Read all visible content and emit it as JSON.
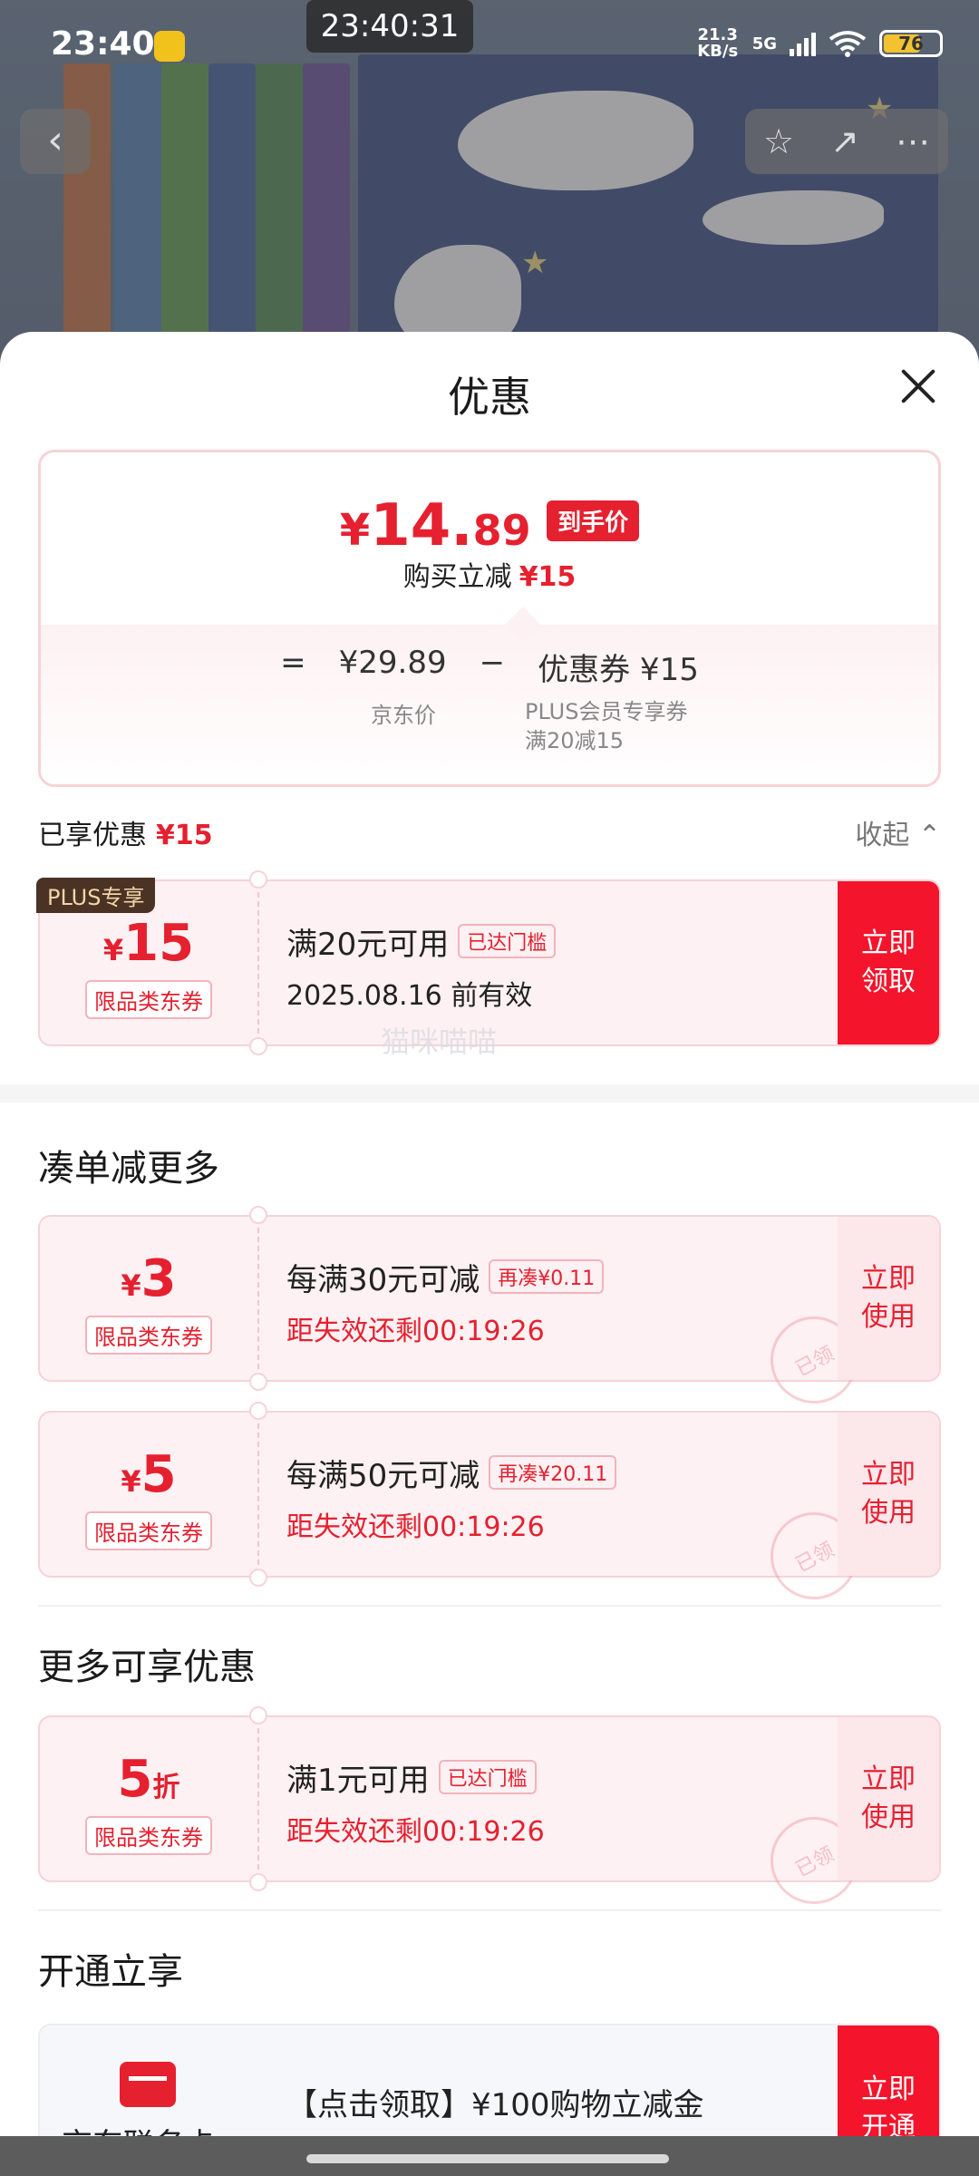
{
  "status_bar": {
    "time": "23:40",
    "center_time": "23:40:31",
    "net_speed": "21.3 KB/s",
    "network": "5G",
    "battery": "76"
  },
  "sheet": {
    "title": "优惠"
  },
  "price_summary": {
    "currency": "¥",
    "price_int": "14.",
    "price_dec": "89",
    "hand_price_tag": "到手价",
    "buy_reduce_label": "购买立减",
    "buy_reduce_value": "¥15",
    "eq": "=",
    "jd_price": "¥29.89",
    "minus": "−",
    "coupon_part": "优惠券 ¥15",
    "jd_price_label": "京东价",
    "coupon_label": "PLUS会员专享券满20减15"
  },
  "enjoyed": {
    "label": "已享优惠",
    "value": "¥15",
    "collapse": "收起"
  },
  "plus_coupon": {
    "badge": "PLUS专享",
    "yen": "¥",
    "amount": "15",
    "scope": "限品类东券",
    "condition": "满20元可用",
    "condition_tag": "已达门槛",
    "validity": "2025.08.16 前有效",
    "action": "立即领取"
  },
  "watermark": "猫咪喵喵",
  "more_section": {
    "title": "凑单减更多",
    "coupons": [
      {
        "yen": "¥",
        "amount": "3",
        "scope": "限品类东券",
        "condition": "每满30元可减",
        "tag": "再凑¥0.11",
        "countdown": "距失效还剩00:19:26",
        "action": "立即使用",
        "stamp": "已领"
      },
      {
        "yen": "¥",
        "amount": "5",
        "scope": "限品类东券",
        "condition": "每满50元可减",
        "tag": "再凑¥20.11",
        "countdown": "距失效还剩00:19:26",
        "action": "立即使用",
        "stamp": "已领"
      }
    ]
  },
  "extra_section": {
    "title": "更多可享优惠",
    "coupon": {
      "amount": "5",
      "suffix": "折",
      "scope": "限品类东券",
      "condition": "满1元可用",
      "tag": "已达门槛",
      "countdown": "距失效还剩00:19:26",
      "action": "立即使用",
      "stamp": "已领"
    }
  },
  "open_section": {
    "title": "开通立享",
    "card": {
      "name": "京东联名卡",
      "text": "【点击领取】¥100购物立减金",
      "action": "立即开通"
    }
  }
}
